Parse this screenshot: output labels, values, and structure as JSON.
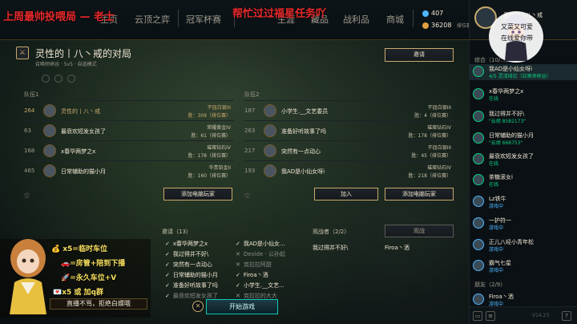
{
  "overlay": {
    "red_left": "上周最帅投喂局 — 老士",
    "red_mid": "帮忙过过福星任务吖",
    "sticker_line1": "又菜又可爱",
    "sticker_line2": "在线爱你带",
    "lines": [
      "x5=临时车位",
      "=房管+陪到下播",
      "=永久车位+V",
      "x5 或  加q群"
    ],
    "bottom": "直播不骂，拒绝白嫖哦"
  },
  "nav": {
    "items": [
      "主页",
      "云顶之弈",
      "冠军杯赛",
      "生涯",
      "藏品",
      "战利品",
      "商城"
    ],
    "blue_essence": "407",
    "orange_essence": "36208",
    "rank_label": "排位赛"
  },
  "lobby": {
    "title": "灵性的丨八丶戒的对局",
    "map": "召唤师峡谷",
    "mode": "5v5 · 自选模式",
    "invite_button": "邀请"
  },
  "team1": {
    "label": "队伍1",
    "players": [
      {
        "level": "264",
        "name": "灵性的丨八丶戒",
        "rank": "不屈白银III",
        "wins": "胜：309（排位赛）",
        "me": true
      },
      {
        "level": "63",
        "name": "最衰欢短发女孩了",
        "rank": "荣耀黄金IV",
        "wins": "胜：61（排位赛）",
        "me": false
      },
      {
        "level": "168",
        "name": "x春华两梦之x",
        "rank": "璀璨钻石IV",
        "wins": "胜：178（排位赛）",
        "me": false
      },
      {
        "level": "465",
        "name": "日常辅助的猫小月",
        "rank": "华贵铂金II",
        "wins": "胜：160（排位赛）",
        "me": false
      }
    ],
    "empty": "空",
    "add_bot": "添加电脑玩家"
  },
  "team2": {
    "label": "队伍2",
    "players": [
      {
        "level": "187",
        "name": "小学生.__文艺委员",
        "rank": "不屈白银III",
        "wins": "胜：4（排位赛）"
      },
      {
        "level": "263",
        "name": "准备好听故事了吗",
        "rank": "璀璨钻石IV",
        "wins": "胜：178（排位赛）"
      },
      {
        "level": "217",
        "name": "突然有一点动心",
        "rank": "不屈白银III",
        "wins": "胜：45（排位赛）"
      },
      {
        "level": "193",
        "name": "我AD是小仙女呀i",
        "rank": "璀璨钻石IV",
        "wins": "胜：218（排位赛）"
      }
    ],
    "empty": "空",
    "join": "加入",
    "add_bot": "添加电脑玩家"
  },
  "invites": {
    "title": "邀请（13）",
    "col1": [
      "x春华两梦之x",
      "我过得并不好\\",
      "突然有一点动心",
      "日常辅助的猫小月",
      "准备好听故事了吗",
      "最衰欢短发女孩了"
    ],
    "col2": [
      "我AD是小仙女...",
      "Dexide · 公孙起",
      "克拉拉阿甜",
      "Firoa丶洒",
      "小学生.__文艺...",
      "克拉拉的大大"
    ]
  },
  "spectators": {
    "title": "观战者（2/2）",
    "names": [
      "我过得并不好\\",
      "Firoa丶洒"
    ],
    "button": "观战"
  },
  "start_button": "开始游戏",
  "social": {
    "profile_name": "灵性的丨八丶戒",
    "group_online": "综合（10/...）",
    "friends": [
      {
        "name": "我AD是小仙女呀i",
        "status": "4/5 灵活排位（召唤师峡谷）",
        "cls": "st",
        "sel": true
      },
      {
        "name": "x春华两梦之x",
        "status": "在线",
        "cls": "st"
      },
      {
        "name": "我过得并不好\\",
        "status": "\"云胡 8582173\"",
        "cls": "st"
      },
      {
        "name": "日常辅助的猫小月",
        "status": "\"云胡 668753\"",
        "cls": "st"
      },
      {
        "name": "最衰欢短发女孩了",
        "status": "在线",
        "cls": "st"
      },
      {
        "name": "茶糖滚女i",
        "status": "在线",
        "cls": "st"
      },
      {
        "name": "Lz铁牛",
        "status": "游戏中",
        "cls": "st ing"
      },
      {
        "name": "一护符一",
        "status": "游戏中",
        "cls": "st ing"
      },
      {
        "name": "正儿八经小青年松",
        "status": "游戏中",
        "cls": "st ing"
      },
      {
        "name": "霸气七星",
        "status": "游戏中",
        "cls": "st ing"
      }
    ],
    "group_friends": "朋友（2/9）",
    "friends2": [
      {
        "name": "Firoa丶洒",
        "status": "游戏中",
        "cls": "st ing"
      }
    ],
    "version": "V14.23"
  },
  "colors": {
    "gold": "#c8aa6e",
    "cyan": "#0ac8b9",
    "online": "#0acf83",
    "red": "#e8292b"
  }
}
